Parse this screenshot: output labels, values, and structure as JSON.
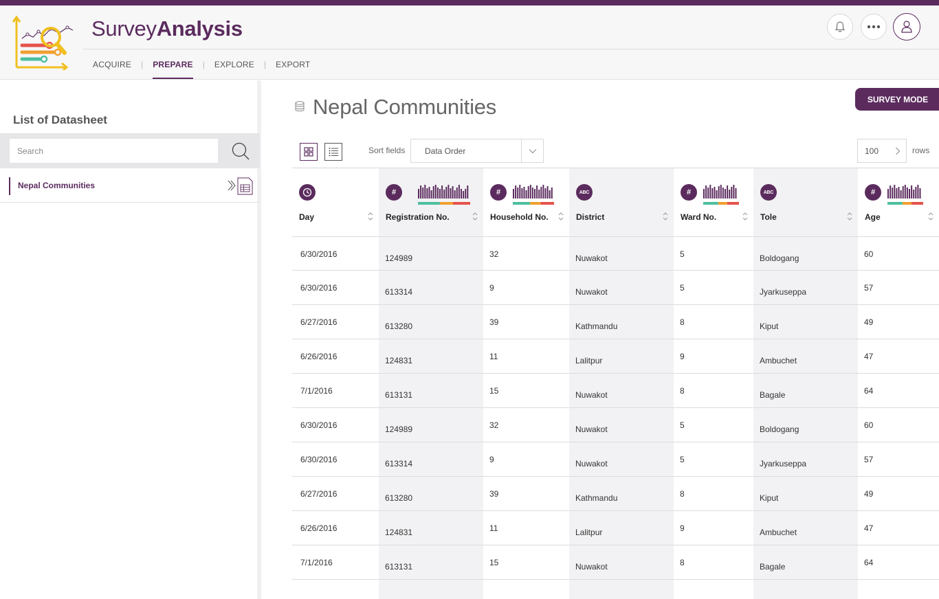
{
  "app": {
    "brand_light": "Survey",
    "brand_bold": "Analysis",
    "accent_color": "#5b2b5e"
  },
  "nav": {
    "items": [
      {
        "label": "ACQUIRE",
        "active": false
      },
      {
        "label": "PREPARE",
        "active": true
      },
      {
        "label": "EXPLORE",
        "active": false
      },
      {
        "label": "EXPORT",
        "active": false
      }
    ]
  },
  "header_actions": {
    "icons": [
      "bell-icon",
      "more-icon",
      "user-icon"
    ]
  },
  "sidebar": {
    "title": "List of Datasheet",
    "search_placeholder": "Search",
    "items": [
      {
        "label": "Nepal Communities"
      }
    ]
  },
  "main": {
    "title": "Nepal Communities",
    "survey_mode_label": "SURVEY MODE",
    "sort_label": "Sort fields",
    "sort_value": "Data Order",
    "rows_value": "100",
    "rows_label": "rows"
  },
  "table": {
    "columns": [
      {
        "label": "Day",
        "type": "date",
        "icon_text": ""
      },
      {
        "label": "Registration No.",
        "type": "number",
        "icon_text": "#"
      },
      {
        "label": "Household No.",
        "type": "number",
        "icon_text": "#"
      },
      {
        "label": "District",
        "type": "text",
        "icon_text": "ABC"
      },
      {
        "label": "Ward No.",
        "type": "number",
        "icon_text": "#"
      },
      {
        "label": "Tole",
        "type": "text",
        "icon_text": "ABC"
      },
      {
        "label": "Age",
        "type": "number",
        "icon_text": "#"
      }
    ],
    "rows": [
      [
        "6/30/2016",
        "124989",
        "32",
        "Nuwakot",
        "5",
        "Boldogang",
        "60"
      ],
      [
        "6/30/2016",
        "613314",
        "9",
        "Nuwakot",
        "5",
        "Jyarkuseppa",
        "57"
      ],
      [
        "6/27/2016",
        "613280",
        "39",
        "Kathmandu",
        "8",
        "Kiput",
        "49"
      ],
      [
        "6/26/2016",
        "124831",
        "11",
        "Lalitpur",
        "9",
        "Ambuchet",
        "47"
      ],
      [
        "7/1/2016",
        "613131",
        "15",
        "Nuwakot",
        "8",
        "Bagale",
        "64"
      ],
      [
        "6/30/2016",
        "124989",
        "32",
        "Nuwakot",
        "5",
        "Boldogang",
        "60"
      ],
      [
        "6/30/2016",
        "613314",
        "9",
        "Nuwakot",
        "5",
        "Jyarkuseppa",
        "57"
      ],
      [
        "6/27/2016",
        "613280",
        "39",
        "Kathmandu",
        "8",
        "Kiput",
        "49"
      ],
      [
        "6/26/2016",
        "124831",
        "11",
        "Lalitpur",
        "9",
        "Ambuchet",
        "47"
      ],
      [
        "7/1/2016",
        "613131",
        "15",
        "Nuwakot",
        "8",
        "Bagale",
        "64"
      ]
    ],
    "quality_colors": [
      "#4dbf9f",
      "#f0a030",
      "#e5534b"
    ]
  }
}
